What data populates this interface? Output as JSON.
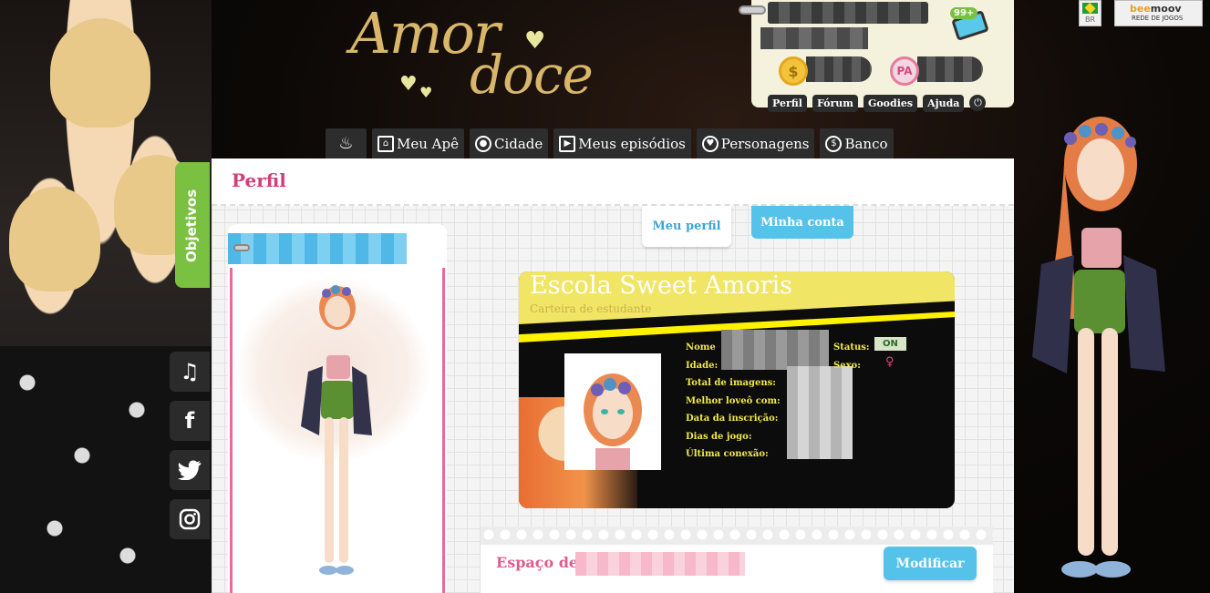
{
  "logo": {
    "line1": "Amor",
    "line2": "doce"
  },
  "account": {
    "notifications_badge": "99+",
    "links": [
      "Perfil",
      "Fórum",
      "Goodies",
      "Ajuda"
    ],
    "power_icon": "power-icon"
  },
  "region": {
    "flag_label": "BR",
    "network_name": "beemoov",
    "network_subtitle": "REDE DE JOGOS"
  },
  "nav": {
    "items": [
      {
        "label": "",
        "icon": "cupcake-icon"
      },
      {
        "label": "Meu Apê",
        "icon": "house-icon"
      },
      {
        "label": "Cidade",
        "icon": "map-pin-icon"
      },
      {
        "label": "Meus episódios",
        "icon": "play-icon"
      },
      {
        "label": "Personagens",
        "icon": "heart-icon"
      },
      {
        "label": "Banco",
        "icon": "coin-icon"
      }
    ]
  },
  "sidebar": {
    "objectives_label": "Objetivos",
    "social": [
      "music-icon",
      "facebook-icon",
      "twitter-icon",
      "instagram-icon"
    ]
  },
  "profile": {
    "page_title": "Perfil",
    "tabs": [
      "Meu perfil",
      "Minha conta"
    ],
    "student_card": {
      "school": "Escola Sweet Amoris",
      "subtitle": "Carteira de estudante",
      "fields": [
        "Nome",
        "Idade:",
        "Total de imagens:",
        "Melhor loveô com:",
        "Data da inscrição:",
        "Dias de jogo:",
        "Última conexão:"
      ],
      "status_label": "Status:",
      "status_value": "ON",
      "sex_label": "Sexo:",
      "sex_value": "♀"
    },
    "space": {
      "title": "Espaço de",
      "modify_button": "Modificar"
    }
  },
  "colors": {
    "accent_pink": "#d23e79",
    "accent_blue": "#55c2ea",
    "accent_green": "#7ac142",
    "card_yellow": "#f1e566"
  }
}
